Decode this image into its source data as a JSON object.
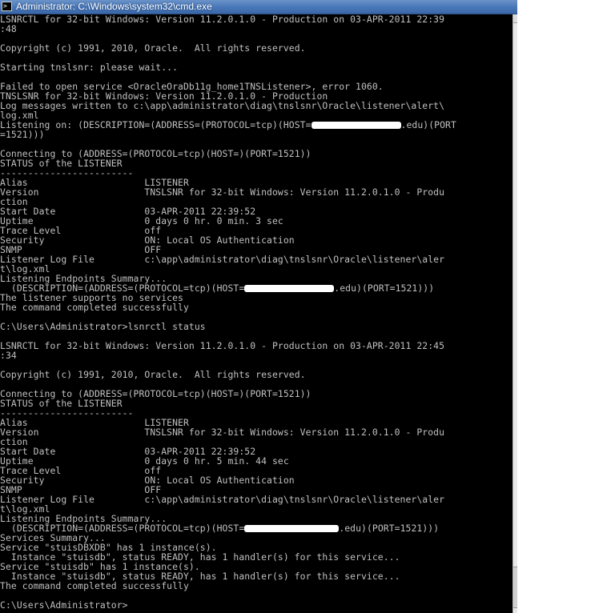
{
  "window": {
    "title": "Administrator: C:\\Windows\\system32\\cmd.exe",
    "icon": "cmd-icon",
    "icon_glyph": ">"
  },
  "console": {
    "lines": [
      "LSNRCTL for 32-bit Windows: Version 11.2.0.1.0 - Production on 03-APR-2011 22:39",
      ":48",
      "",
      "Copyright (c) 1991, 2010, Oracle.  All rights reserved.",
      "",
      "Starting tnslsnr: please wait...",
      "",
      "Failed to open service <OracleOraDb11g_home1TNSListener>, error 1060.",
      "TNSLSNR for 32-bit Windows: Version 11.2.0.1.0 - Production",
      "Log messages written to c:\\app\\administrator\\diag\\tnslsnr\\Oracle\\listener\\alert\\",
      "log.xml",
      "Listening on: (DESCRIPTION=(ADDRESS=(PROTOCOL=tcp)(HOST=",
      "=1521)))",
      "",
      "Connecting to (ADDRESS=(PROTOCOL=tcp)(HOST=)(PORT=1521))",
      "STATUS of the LISTENER",
      "------------------------",
      "Alias                     LISTENER",
      "Version                   TNSLSNR for 32-bit Windows: Version 11.2.0.1.0 - Produ",
      "ction",
      "Start Date                03-APR-2011 22:39:52",
      "Uptime                    0 days 0 hr. 0 min. 3 sec",
      "Trace Level               off",
      "Security                  ON: Local OS Authentication",
      "SNMP                      OFF",
      "Listener Log File         c:\\app\\administrator\\diag\\tnslsnr\\Oracle\\listener\\aler",
      "t\\log.xml",
      "Listening Endpoints Summary...",
      "  (DESCRIPTION=(ADDRESS=(PROTOCOL=tcp)(HOST=",
      "The listener supports no services",
      "The command completed successfully",
      "",
      "C:\\Users\\Administrator>lsnrctl status",
      "",
      "LSNRCTL for 32-bit Windows: Version 11.2.0.1.0 - Production on 03-APR-2011 22:45",
      ":34",
      "",
      "Copyright (c) 1991, 2010, Oracle.  All rights reserved.",
      "",
      "Connecting to (ADDRESS=(PROTOCOL=tcp)(HOST=)(PORT=1521))",
      "STATUS of the LISTENER",
      "------------------------",
      "Alias                     LISTENER",
      "Version                   TNSLSNR for 32-bit Windows: Version 11.2.0.1.0 - Produ",
      "ction",
      "Start Date                03-APR-2011 22:39:52",
      "Uptime                    0 days 0 hr. 5 min. 44 sec",
      "Trace Level               off",
      "Security                  ON: Local OS Authentication",
      "SNMP                      OFF",
      "Listener Log File         c:\\app\\administrator\\diag\\tnslsnr\\Oracle\\listener\\aler",
      "t\\log.xml",
      "Listening Endpoints Summary...",
      "  (DESCRIPTION=(ADDRESS=(PROTOCOL=tcp)(HOST=",
      "Services Summary...",
      "Service \"stuisDBXDB\" has 1 instance(s).",
      "  Instance \"stuisdb\", status READY, has 1 handler(s) for this service...",
      "Service \"stuisdb\" has 1 instance(s).",
      "  Instance \"stuisdb\", status READY, has 1 handler(s) for this service...",
      "The command completed successfully",
      "",
      "C:\\Users\\Administrator>"
    ],
    "redactions": {
      "11": {
        "after": ".edu)(PORT"
      },
      "28": {
        "after": ".edu)(PORT=1521)))"
      },
      "53": {
        "after": ".edu)(PORT=1521)))"
      }
    },
    "cursor_line": 62
  },
  "colors": {
    "console_bg": "#000000",
    "console_fg": "#c0c0c0",
    "titlebar": "#4a78b8"
  }
}
